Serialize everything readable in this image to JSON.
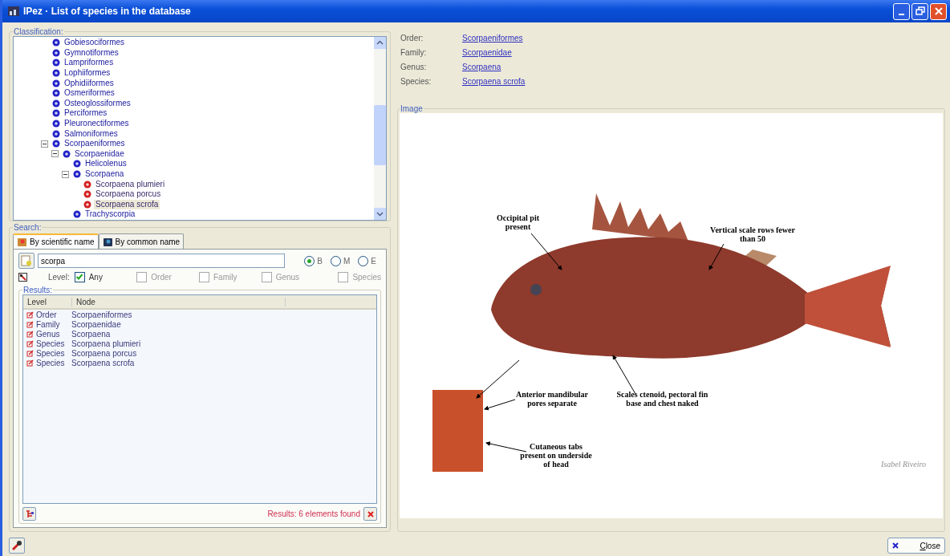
{
  "window": {
    "title": "IPez · List of species in the database"
  },
  "classification": {
    "label": "Classification:",
    "tree": [
      {
        "label": "Gobiesociformes",
        "kind": "order",
        "selected": false
      },
      {
        "label": "Gymnotiformes",
        "kind": "order",
        "selected": false
      },
      {
        "label": "Lampriformes",
        "kind": "order",
        "selected": false
      },
      {
        "label": "Lophiiformes",
        "kind": "order",
        "selected": false
      },
      {
        "label": "Ophidiiformes",
        "kind": "order",
        "selected": false
      },
      {
        "label": "Osmeriformes",
        "kind": "order",
        "selected": false
      },
      {
        "label": "Osteoglossiformes",
        "kind": "order",
        "selected": false
      },
      {
        "label": "Perciformes",
        "kind": "order",
        "selected": false
      },
      {
        "label": "Pleuronectiformes",
        "kind": "order",
        "selected": false
      },
      {
        "label": "Salmoniformes",
        "kind": "order",
        "selected": false
      },
      {
        "label": "Scorpaeniformes",
        "kind": "order",
        "selected": false,
        "expanded": true,
        "children": [
          {
            "label": "Scorpaenidae",
            "kind": "family",
            "selected": false,
            "expanded": true,
            "children": [
              {
                "label": "Helicolenus",
                "kind": "genus",
                "selected": false
              },
              {
                "label": "Scorpaena",
                "kind": "genus",
                "selected": false,
                "expanded": true,
                "children": [
                  {
                    "label": "Scorpaena plumieri",
                    "kind": "species",
                    "selected": false
                  },
                  {
                    "label": "Scorpaena porcus",
                    "kind": "species",
                    "selected": false
                  },
                  {
                    "label": "Scorpaena scrofa",
                    "kind": "species",
                    "selected": true
                  }
                ]
              },
              {
                "label": "Trachyscorpia",
                "kind": "genus",
                "selected": false
              }
            ]
          }
        ]
      }
    ]
  },
  "search": {
    "label": "Search:",
    "tabs": [
      {
        "label": "By scientific name",
        "selected": true
      },
      {
        "label": "By common name",
        "selected": false
      }
    ],
    "query": "scorpa",
    "positions": [
      {
        "label": "B",
        "selected": true
      },
      {
        "label": "M",
        "selected": false
      },
      {
        "label": "E",
        "selected": false
      }
    ],
    "level_label": "Level:",
    "levels": [
      {
        "label": "Any",
        "checked": true
      },
      {
        "label": "Order",
        "checked": false
      },
      {
        "label": "Family",
        "checked": false
      },
      {
        "label": "Genus",
        "checked": false
      },
      {
        "label": "Species",
        "checked": false
      }
    ],
    "results": {
      "label": "Results:",
      "columns": [
        "Level",
        "Node"
      ],
      "rows": [
        {
          "level": "Order",
          "node": "Scorpaeniformes"
        },
        {
          "level": "Family",
          "node": "Scorpaenidae"
        },
        {
          "level": "Genus",
          "node": "Scorpaena"
        },
        {
          "level": "Species",
          "node": "Scorpaena plumieri"
        },
        {
          "level": "Species",
          "node": "Scorpaena porcus"
        },
        {
          "level": "Species",
          "node": "Scorpaena scrofa"
        }
      ],
      "status": "Results: 6 elements found"
    }
  },
  "details": [
    {
      "label": "Order:",
      "value": "Scorpaeniformes"
    },
    {
      "label": "Family:",
      "value": "Scorpaenidae"
    },
    {
      "label": "Genus:",
      "value": "Scorpaena"
    },
    {
      "label": "Species:",
      "value": "Scorpaena scrofa"
    }
  ],
  "image": {
    "label": "Image",
    "annotations": [
      "Occipital pit present",
      "Vertical scale rows fewer than 50",
      "Anterior mandibular pores separate",
      "Scales ctenoid, pectoral fin base and chest naked",
      "Cutaneous tabs present on underside of head"
    ],
    "credit": "Isabel Riveiro"
  },
  "close_button": "Close"
}
